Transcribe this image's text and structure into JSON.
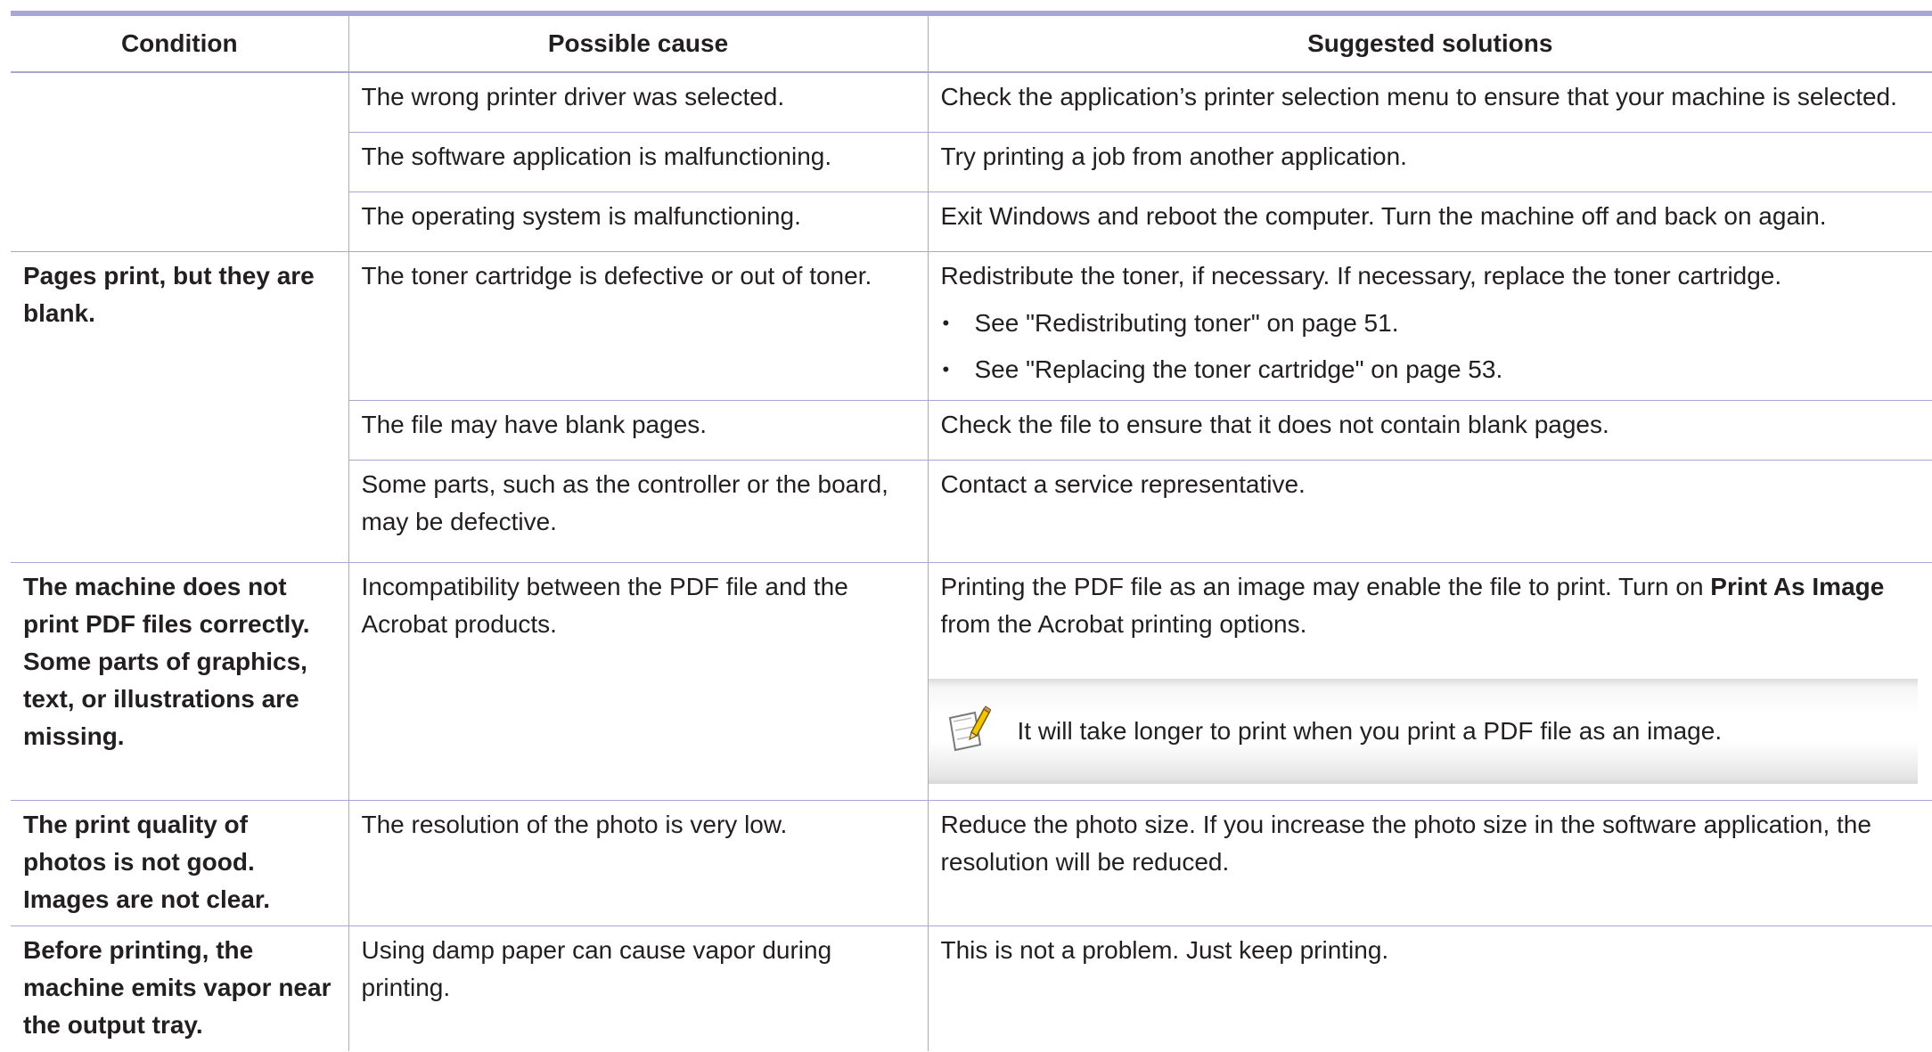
{
  "table": {
    "headers": {
      "condition": "Condition",
      "cause": "Possible cause",
      "solutions": "Suggested solutions"
    },
    "rows": [
      {
        "cause": "The wrong printer driver was selected.",
        "solution": "Check the application’s printer selection menu to ensure that your machine is selected."
      },
      {
        "cause": "The software application is malfunctioning.",
        "solution": "Try printing a job from another application."
      },
      {
        "cause": "The operating system is malfunctioning.",
        "solution": "Exit Windows and reboot the computer. Turn the machine off and back on again."
      }
    ],
    "blank_pages": {
      "condition": "Pages print, but they are blank.",
      "rows": [
        {
          "cause": "The toner cartridge is defective or out of toner.",
          "solution": "Redistribute the toner, if necessary. If necessary, replace the toner cartridge.",
          "bullets": [
            "See \"Redistributing toner\" on page 51.",
            "See \"Replacing the toner cartridge\" on page 53."
          ]
        },
        {
          "cause": "The file may have blank pages.",
          "solution": "Check the file to ensure that it does not contain blank pages."
        },
        {
          "cause": "Some parts, such as the controller or the board, may be defective.",
          "solution": "Contact a service representative."
        }
      ]
    },
    "pdf": {
      "condition": "The machine does not print PDF files correctly. Some parts of graphics, text, or illustrations are missing.",
      "cause": "Incompatibility between the PDF file and the Acrobat products.",
      "solution_before": "Printing the PDF file as an image may enable the file to print. Turn on ",
      "solution_bold": "Print As Image",
      "solution_after": " from the Acrobat printing options.",
      "note": "It will take longer to print when you print a PDF file as an image."
    },
    "photo": {
      "condition": "The print quality of photos is not good. Images are not clear.",
      "cause": "The resolution of the photo is very low.",
      "solution": "Reduce the photo size. If you increase the photo size in the software application, the resolution will be reduced."
    },
    "vapor": {
      "condition": "Before printing, the machine emits vapor near the output tray.",
      "cause": "Using damp paper can cause vapor during printing.",
      "solution": "This is not a problem. Just keep printing."
    }
  },
  "bullet_glyph": "•",
  "colors": {
    "border": "#a7a7d6",
    "text": "#231f20"
  },
  "icons": {
    "note": "note-pencil-icon"
  }
}
